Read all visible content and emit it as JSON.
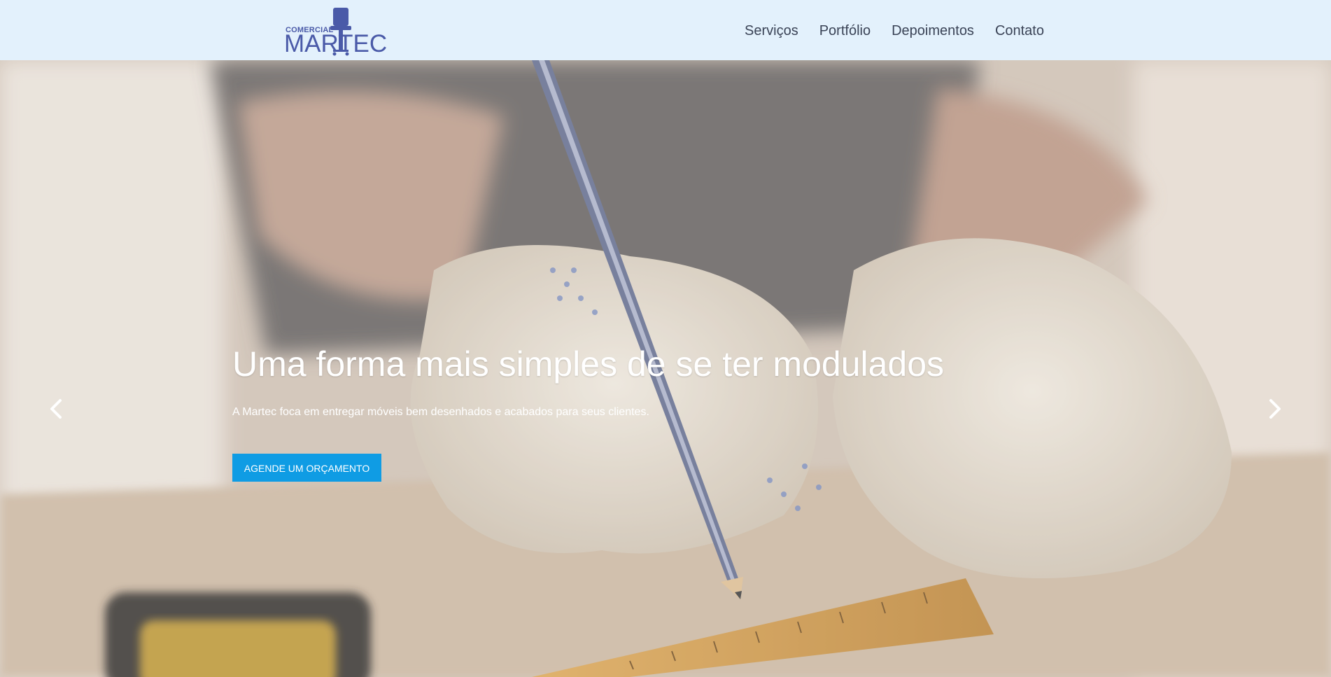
{
  "header": {
    "logo": {
      "small_text": "COMERCIAL",
      "big_text": "MARTEC",
      "icon": "chair-icon",
      "color": "#4a5aa8"
    },
    "nav": [
      {
        "label": "Serviços"
      },
      {
        "label": "Portfólio"
      },
      {
        "label": "Depoimentos"
      },
      {
        "label": "Contato"
      }
    ],
    "background": "#e3f1fc"
  },
  "hero": {
    "title": "Uma forma mais simples de se ter modulados",
    "subtitle": "A Martec foca em entregar móveis bem desenhados e acabados para seus clientes.",
    "cta_label": "AGENDE UM ORÇAMENTO",
    "cta_color": "#0f9ce4",
    "prev_icon": "chevron-left-icon",
    "next_icon": "chevron-right-icon"
  }
}
